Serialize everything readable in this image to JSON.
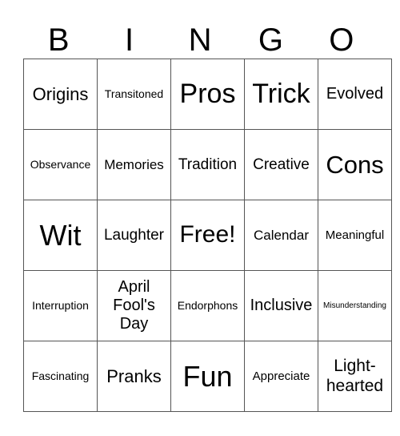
{
  "header": [
    "B",
    "I",
    "N",
    "G",
    "O"
  ],
  "cells": [
    [
      {
        "text": "Origins",
        "size": 22
      },
      {
        "text": "Transitoned",
        "size": 14
      },
      {
        "text": "Pros",
        "size": 34
      },
      {
        "text": "Trick",
        "size": 34
      },
      {
        "text": "Evolved",
        "size": 20
      }
    ],
    [
      {
        "text": "Observance",
        "size": 14
      },
      {
        "text": "Memories",
        "size": 17
      },
      {
        "text": "Tradition",
        "size": 19
      },
      {
        "text": "Creative",
        "size": 19
      },
      {
        "text": "Cons",
        "size": 31
      }
    ],
    [
      {
        "text": "Wit",
        "size": 36
      },
      {
        "text": "Laughter",
        "size": 19
      },
      {
        "text": "Free!",
        "size": 30
      },
      {
        "text": "Calendar",
        "size": 17
      },
      {
        "text": "Meaningful",
        "size": 15
      }
    ],
    [
      {
        "text": "Interruption",
        "size": 14
      },
      {
        "text": "April Fool's Day",
        "size": 20
      },
      {
        "text": "Endorphons",
        "size": 14
      },
      {
        "text": "Inclusive",
        "size": 20
      },
      {
        "text": "Misunderstanding",
        "size": 10
      }
    ],
    [
      {
        "text": "Fascinating",
        "size": 14
      },
      {
        "text": "Pranks",
        "size": 22
      },
      {
        "text": "Fun",
        "size": 36
      },
      {
        "text": "Appreciate",
        "size": 15
      },
      {
        "text": "Light-hearted",
        "size": 21
      }
    ]
  ]
}
